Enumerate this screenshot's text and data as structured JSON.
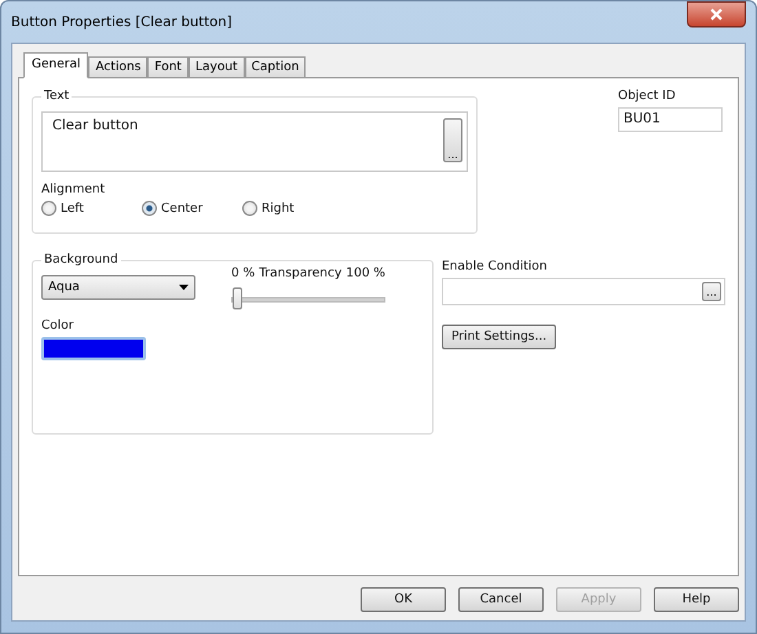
{
  "window": {
    "title": "Button Properties [Clear button]"
  },
  "tabs": [
    {
      "label": "General",
      "selected": true
    },
    {
      "label": "Actions",
      "selected": false
    },
    {
      "label": "Font",
      "selected": false
    },
    {
      "label": "Layout",
      "selected": false
    },
    {
      "label": "Caption",
      "selected": false
    }
  ],
  "text_group": {
    "title": "Text",
    "value": "Clear button",
    "browse": "...",
    "alignment_label": "Alignment",
    "alignment": [
      {
        "label": "Left",
        "selected": false
      },
      {
        "label": "Center",
        "selected": true
      },
      {
        "label": "Right",
        "selected": false
      }
    ]
  },
  "object_id": {
    "label": "Object ID",
    "value": "BU01"
  },
  "background_group": {
    "title": "Background",
    "dropdown": "Aqua",
    "transparency": {
      "min": "0 %",
      "label": "Transparency",
      "max": "100 %",
      "level": 0
    },
    "color_label": "Color",
    "color": "#0000ee"
  },
  "enable_condition": {
    "label": "Enable Condition",
    "browse": "..."
  },
  "print_settings": "Print Settings...",
  "buttons": [
    {
      "label": "OK",
      "disabled": false
    },
    {
      "label": "Cancel",
      "disabled": false
    },
    {
      "label": "Apply",
      "disabled": true
    },
    {
      "label": "Help",
      "disabled": false
    }
  ]
}
